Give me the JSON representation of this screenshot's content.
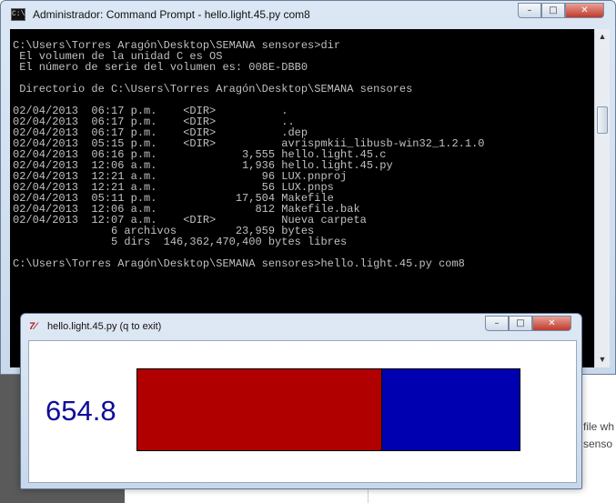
{
  "cmd_window": {
    "title": "Administrador: Command Prompt - hello.light.45.py  com8",
    "icon_text": "C:\\",
    "console_lines": [
      "C:\\Users\\Torres Aragón\\Desktop\\SEMANA sensores>dir",
      " El volumen de la unidad C es OS",
      " El número de serie del volumen es: 008E-DBB0",
      "",
      " Directorio de C:\\Users\\Torres Aragón\\Desktop\\SEMANA sensores",
      "",
      "02/04/2013  06:17 p.m.    <DIR>          .",
      "02/04/2013  06:17 p.m.    <DIR>          ..",
      "02/04/2013  06:17 p.m.    <DIR>          .dep",
      "02/04/2013  05:15 p.m.    <DIR>          avrispmkii_libusb-win32_1.2.1.0",
      "02/04/2013  06:16 p.m.             3,555 hello.light.45.c",
      "02/04/2013  12:06 a.m.             1,936 hello.light.45.py",
      "02/04/2013  12:21 a.m.                96 LUX.pnproj",
      "02/04/2013  12:21 a.m.                56 LUX.pnps",
      "02/04/2013  05:11 p.m.            17,504 Makefile",
      "02/04/2013  12:06 a.m.               812 Makefile.bak",
      "02/04/2013  12:07 a.m.    <DIR>          Nueva carpeta",
      "               6 archivos         23,959 bytes",
      "               5 dirs  146,362,470,400 bytes libres",
      "",
      "C:\\Users\\Torres Aragón\\Desktop\\SEMANA sensores>hello.light.45.py com8"
    ],
    "buttons": {
      "minimize": "–",
      "maximize": "□",
      "close": "✕"
    }
  },
  "tk_window": {
    "title": "hello.light.45.py (q to exit)",
    "icon_text": "7⁄",
    "buttons": {
      "minimize": "–",
      "maximize": "□",
      "close": "✕"
    },
    "reading": "654.8",
    "bar_fraction": 0.64,
    "bar_color_low": "#b00000",
    "bar_color_high": "#0000b0"
  },
  "background": {
    "text_line1": "file wh",
    "text_line2": "senso"
  }
}
